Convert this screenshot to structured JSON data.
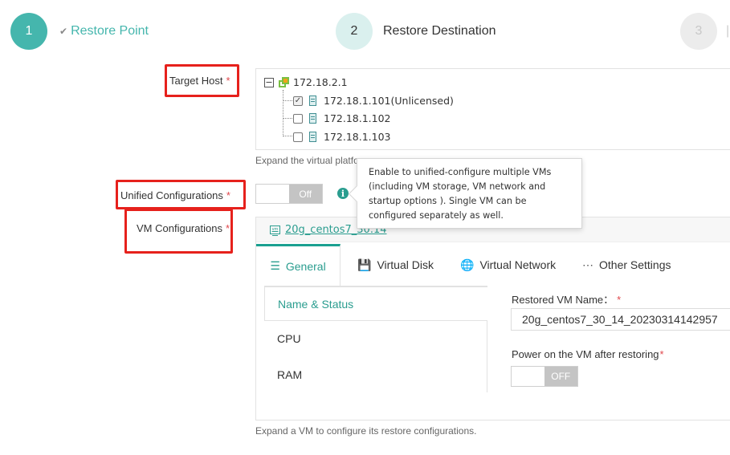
{
  "stepper": {
    "steps": [
      {
        "number": "1",
        "label": "Restore Point",
        "status": "completed"
      },
      {
        "number": "2",
        "label": "Restore Destination",
        "status": "active"
      },
      {
        "number": "3",
        "label": "",
        "status": "pending"
      }
    ]
  },
  "form": {
    "target_host": {
      "label": "Target Host",
      "required_mark": "*",
      "tree": {
        "root": {
          "label": "172.18.2.1",
          "expanded": true,
          "icon": "vcenter-icon"
        },
        "children": [
          {
            "label": "172.18.1.101(Unlicensed)",
            "checked": true,
            "icon": "server-icon"
          },
          {
            "label": "172.18.1.102",
            "checked": false,
            "icon": "server-icon"
          },
          {
            "label": "172.18.1.103",
            "checked": false,
            "icon": "server-icon"
          }
        ]
      },
      "hint": "Expand the virtual platfo"
    },
    "unified_configurations": {
      "label": "Unified Configurations",
      "required_mark": "*",
      "switch_state": "Off",
      "tooltip": "Enable to unified-configure multiple VMs (including VM storage, VM network and startup options ). Single VM can be configured separately as well."
    },
    "vm_configurations": {
      "label": "VM Configurations",
      "required_mark": "*",
      "vm_name_link": "20g_centos7_30.14",
      "tabs": [
        {
          "label": "General",
          "icon": "sliders-icon",
          "active": true
        },
        {
          "label": "Virtual Disk",
          "icon": "floppy-disk-icon",
          "active": false
        },
        {
          "label": "Virtual Network",
          "icon": "globe-icon",
          "active": false
        },
        {
          "label": "Other Settings",
          "icon": "more-circle-icon",
          "active": false
        }
      ],
      "side_items": [
        {
          "label": "Name & Status",
          "active": true
        },
        {
          "label": "CPU",
          "active": false
        },
        {
          "label": "RAM",
          "active": false
        }
      ],
      "restored_vm_name_label": "Restored VM Name：",
      "restored_vm_name_required": "*",
      "restored_vm_name_value": "20g_centos7_30_14_20230314142957",
      "power_on_label": "Power on the VM after restoring",
      "power_on_required": "*",
      "power_on_state": "OFF",
      "hint": "Expand a VM to configure its restore configurations."
    }
  },
  "colors": {
    "accent": "#45b6ad",
    "link": "#2a9d8f",
    "required": "#e0474c",
    "annotation": "#e6211c"
  }
}
